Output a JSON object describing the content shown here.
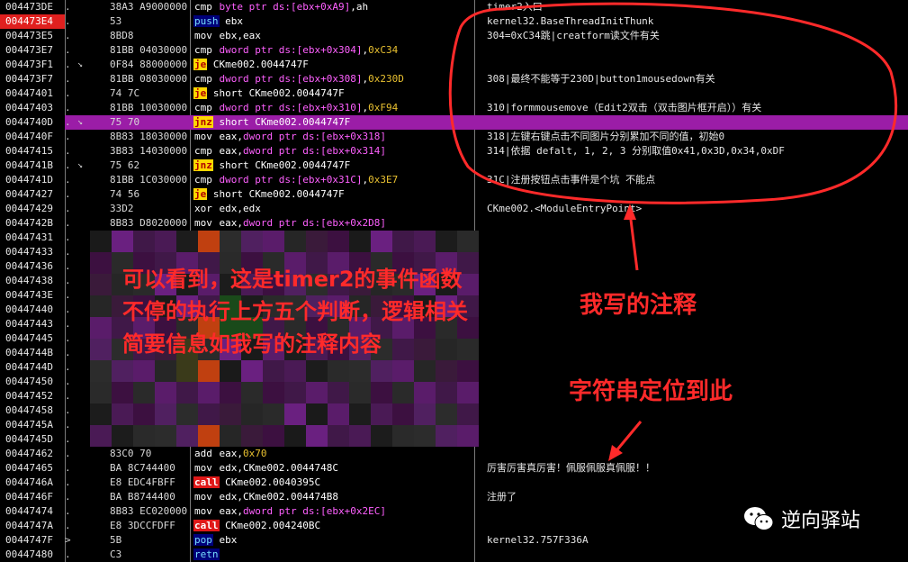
{
  "rows": [
    {
      "addr": "004473DE",
      "mark": ".",
      "bytes": "38A3 A9000000",
      "tokens": [
        {
          "t": "cmp",
          "c": "mn mn-cmp"
        },
        {
          "t": " byte ptr ds:[ebx+0xA9]",
          "c": "op-mem"
        },
        {
          "t": ",ah",
          "c": "op-reg"
        }
      ],
      "cmt": "timer2入口"
    },
    {
      "addr": "004473E4",
      "mark": ".",
      "bytes": "53",
      "hl": true,
      "tokens": [
        {
          "t": "push",
          "c": "mn mn-push"
        },
        {
          "t": " ebx",
          "c": "op-reg"
        }
      ],
      "cmt": "kernel32.BaseThreadInitThunk"
    },
    {
      "addr": "004473E5",
      "mark": ".",
      "bytes": "8BD8",
      "tokens": [
        {
          "t": "mov",
          "c": "mn mn-mov"
        },
        {
          "t": " ebx,eax",
          "c": "op-reg"
        }
      ],
      "cmt": "304=0xC34跳|creatform读文件有关"
    },
    {
      "addr": "004473E7",
      "mark": ".",
      "bytes": "81BB 04030000",
      "tokens": [
        {
          "t": "cmp",
          "c": "mn mn-cmp"
        },
        {
          "t": " dword ptr ds:[ebx+0x304]",
          "c": "op-mem"
        },
        {
          "t": ",",
          "c": "op-reg"
        },
        {
          "t": "0xC34",
          "c": "op-num"
        }
      ],
      "cmt": ""
    },
    {
      "addr": "004473F1",
      "mark": ".",
      "bytes": "0F84 88000000",
      "arrow": "v",
      "tokens": [
        {
          "t": "je",
          "c": "mn mn-je"
        },
        {
          "t": " CKme002.0044747F",
          "c": "op-lbl"
        }
      ],
      "cmt": ""
    },
    {
      "addr": "004473F7",
      "mark": ".",
      "bytes": "81BB 08030000",
      "tokens": [
        {
          "t": "cmp",
          "c": "mn mn-cmp"
        },
        {
          "t": " dword ptr ds:[ebx+0x308]",
          "c": "op-mem"
        },
        {
          "t": ",",
          "c": "op-reg"
        },
        {
          "t": "0x230D",
          "c": "op-num"
        }
      ],
      "cmt": "308|最终不能等于230D|button1mousedown有关"
    },
    {
      "addr": "00447401",
      "mark": ".",
      "bytes": "74 7C",
      "tokens": [
        {
          "t": "je",
          "c": "mn mn-je"
        },
        {
          "t": " short CKme002.0044747F",
          "c": "op-lbl"
        }
      ],
      "cmt": ""
    },
    {
      "addr": "00447403",
      "mark": ".",
      "bytes": "81BB 10030000",
      "tokens": [
        {
          "t": "cmp",
          "c": "mn mn-cmp"
        },
        {
          "t": " dword ptr ds:[ebx+0x310]",
          "c": "op-mem"
        },
        {
          "t": ",",
          "c": "op-reg"
        },
        {
          "t": "0xF94",
          "c": "op-num"
        }
      ],
      "cmt": "310|formmousemove（Edit2双击（双击图片框开启））有关"
    },
    {
      "addr": "0044740D",
      "mark": ".",
      "bytes": "75 70",
      "arrow": "v",
      "purple": true,
      "tokens": [
        {
          "t": "jnz",
          "c": "mn mn-jnz"
        },
        {
          "t": " short CKme002.0044747F",
          "c": "op-lbl"
        }
      ],
      "cmt": ""
    },
    {
      "addr": "0044740F",
      "mark": ".",
      "bytes": "8B83 18030000",
      "tokens": [
        {
          "t": "mov",
          "c": "mn mn-mov"
        },
        {
          "t": " eax,",
          "c": "op-reg"
        },
        {
          "t": "dword ptr ds:[ebx+0x318]",
          "c": "op-mem"
        }
      ],
      "cmt": "318|左键右键点击不同图片分别累加不同的值，初始0"
    },
    {
      "addr": "00447415",
      "mark": ".",
      "bytes": "3B83 14030000",
      "tokens": [
        {
          "t": "cmp",
          "c": "mn mn-cmp"
        },
        {
          "t": " eax,",
          "c": "op-reg"
        },
        {
          "t": "dword ptr ds:[ebx+0x314]",
          "c": "op-mem"
        }
      ],
      "cmt": "314|依据 defalt, 1, 2, 3 分别取值0x41,0x3D,0x34,0xDF"
    },
    {
      "addr": "0044741B",
      "mark": ".",
      "bytes": "75 62",
      "arrow": "v",
      "tokens": [
        {
          "t": "jnz",
          "c": "mn mn-jnz"
        },
        {
          "t": " short CKme002.0044747F",
          "c": "op-lbl"
        }
      ],
      "cmt": ""
    },
    {
      "addr": "0044741D",
      "mark": ".",
      "bytes": "81BB 1C030000",
      "tokens": [
        {
          "t": "cmp",
          "c": "mn mn-cmp"
        },
        {
          "t": " dword ptr ds:[ebx+0x31C]",
          "c": "op-mem"
        },
        {
          "t": ",",
          "c": "op-reg"
        },
        {
          "t": "0x3E7",
          "c": "op-num"
        }
      ],
      "cmt": "31C|注册按钮点击事件是个坑 不能点"
    },
    {
      "addr": "00447427",
      "mark": ".",
      "bytes": "74 56",
      "tokens": [
        {
          "t": "je",
          "c": "mn mn-je"
        },
        {
          "t": " short CKme002.0044747F",
          "c": "op-lbl"
        }
      ],
      "cmt": ""
    },
    {
      "addr": "00447429",
      "mark": ".",
      "bytes": "33D2",
      "tokens": [
        {
          "t": "xor",
          "c": "mn mn-xor"
        },
        {
          "t": " edx,edx",
          "c": "op-reg"
        }
      ],
      "cmt": "CKme002.<ModuleEntryPoint>"
    },
    {
      "addr": "0044742B",
      "mark": ".",
      "bytes": "8B83 D8020000",
      "tokens": [
        {
          "t": "mov",
          "c": "mn mn-mov"
        },
        {
          "t": " eax,",
          "c": "op-reg"
        },
        {
          "t": "dword ptr ds:[ebx+0x2D8]",
          "c": "op-mem"
        }
      ],
      "cmt": ""
    },
    {
      "addr": "00447431",
      "mark": ".",
      "bytes": "",
      "tokens": [],
      "cmt": ""
    },
    {
      "addr": "00447433",
      "mark": ".",
      "bytes": "",
      "tokens": [],
      "cmt": ""
    },
    {
      "addr": "00447436",
      "mark": ".",
      "bytes": "",
      "tokens": [],
      "cmt": ""
    },
    {
      "addr": "00447438",
      "mark": ".",
      "bytes": "",
      "tokens": [],
      "cmt": ""
    },
    {
      "addr": "0044743E",
      "mark": ".",
      "bytes": "",
      "tokens": [],
      "cmt": ""
    },
    {
      "addr": "00447440",
      "mark": ".",
      "bytes": "",
      "tokens": [],
      "cmt": ""
    },
    {
      "addr": "00447443",
      "mark": ".",
      "bytes": "",
      "tokens": [],
      "cmt": ""
    },
    {
      "addr": "00447445",
      "mark": ".",
      "bytes": "",
      "tokens": [],
      "cmt": ""
    },
    {
      "addr": "0044744B",
      "mark": ".",
      "bytes": "",
      "tokens": [],
      "cmt": ""
    },
    {
      "addr": "0044744D",
      "mark": ".",
      "bytes": "",
      "tokens": [],
      "cmt": ""
    },
    {
      "addr": "00447450",
      "mark": ".",
      "bytes": "",
      "tokens": [],
      "cmt": ""
    },
    {
      "addr": "00447452",
      "mark": ".",
      "bytes": "",
      "tokens": [],
      "cmt": ""
    },
    {
      "addr": "00447458",
      "mark": ".",
      "bytes": "",
      "tokens": [],
      "cmt": ""
    },
    {
      "addr": "0044745A",
      "mark": ".",
      "bytes": "",
      "tokens": [],
      "cmt": ""
    },
    {
      "addr": "0044745D",
      "mark": ".",
      "bytes": "",
      "tokens": [],
      "cmt": ""
    },
    {
      "addr": "00447462",
      "mark": ".",
      "bytes": "83C0 70",
      "tokens": [
        {
          "t": "add",
          "c": "mn mn-add"
        },
        {
          "t": " eax,",
          "c": "op-reg"
        },
        {
          "t": "0x70",
          "c": "op-num"
        }
      ],
      "cmt": ""
    },
    {
      "addr": "00447465",
      "mark": ".",
      "bytes": "BA 8C744400",
      "tokens": [
        {
          "t": "mov",
          "c": "mn mn-mov"
        },
        {
          "t": " edx,CKme002.0044748C",
          "c": "op-reg"
        }
      ],
      "cmt": "厉害厉害真厉害！佩服佩服真佩服！！"
    },
    {
      "addr": "0044746A",
      "mark": ".",
      "bytes": "E8 EDC4FBFF",
      "tokens": [
        {
          "t": "call",
          "c": "mn mn-call"
        },
        {
          "t": " CKme002.0040395C",
          "c": "op-lbl"
        }
      ],
      "cmt": ""
    },
    {
      "addr": "0044746F",
      "mark": ".",
      "bytes": "BA B8744400",
      "tokens": [
        {
          "t": "mov",
          "c": "mn mn-mov"
        },
        {
          "t": " edx,CKme002.004474B8",
          "c": "op-reg"
        }
      ],
      "cmt": "注册了"
    },
    {
      "addr": "00447474",
      "mark": ".",
      "bytes": "8B83 EC020000",
      "tokens": [
        {
          "t": "mov",
          "c": "mn mn-mov"
        },
        {
          "t": " eax,",
          "c": "op-reg"
        },
        {
          "t": "dword ptr ds:[ebx+0x2EC]",
          "c": "op-mem"
        }
      ],
      "cmt": ""
    },
    {
      "addr": "0044747A",
      "mark": ".",
      "bytes": "E8 3DCCFDFF",
      "tokens": [
        {
          "t": "call",
          "c": "mn mn-call"
        },
        {
          "t": " CKme002.004240BC",
          "c": "op-lbl"
        }
      ],
      "cmt": ""
    },
    {
      "addr": "0044747F",
      "mark": ">",
      "bytes": "5B",
      "tokens": [
        {
          "t": "pop",
          "c": "mn mn-pop"
        },
        {
          "t": " ebx",
          "c": "op-reg"
        }
      ],
      "cmt": "kernel32.757F336A"
    },
    {
      "addr": "00447480",
      "mark": ".",
      "bytes": "C3",
      "tokens": [
        {
          "t": "retn",
          "c": "mn mn-retn"
        }
      ],
      "cmt": ""
    }
  ],
  "annotations": {
    "overlay_lines": [
      "可以看到，这是timer2的事件函数",
      "不停的执行上方五个判断，逻辑相关",
      "简要信息如我写的注释内容"
    ],
    "my_comment_label": "我写的注释",
    "string_locate_label": "字符串定位到此"
  },
  "watermark": {
    "text": "逆向驿站",
    "icon": "wechat-icon"
  },
  "colors": {
    "highlight_red": "#e0201f",
    "purple_row": "#9b1da7",
    "annotation_red": "#ff2a2a"
  }
}
